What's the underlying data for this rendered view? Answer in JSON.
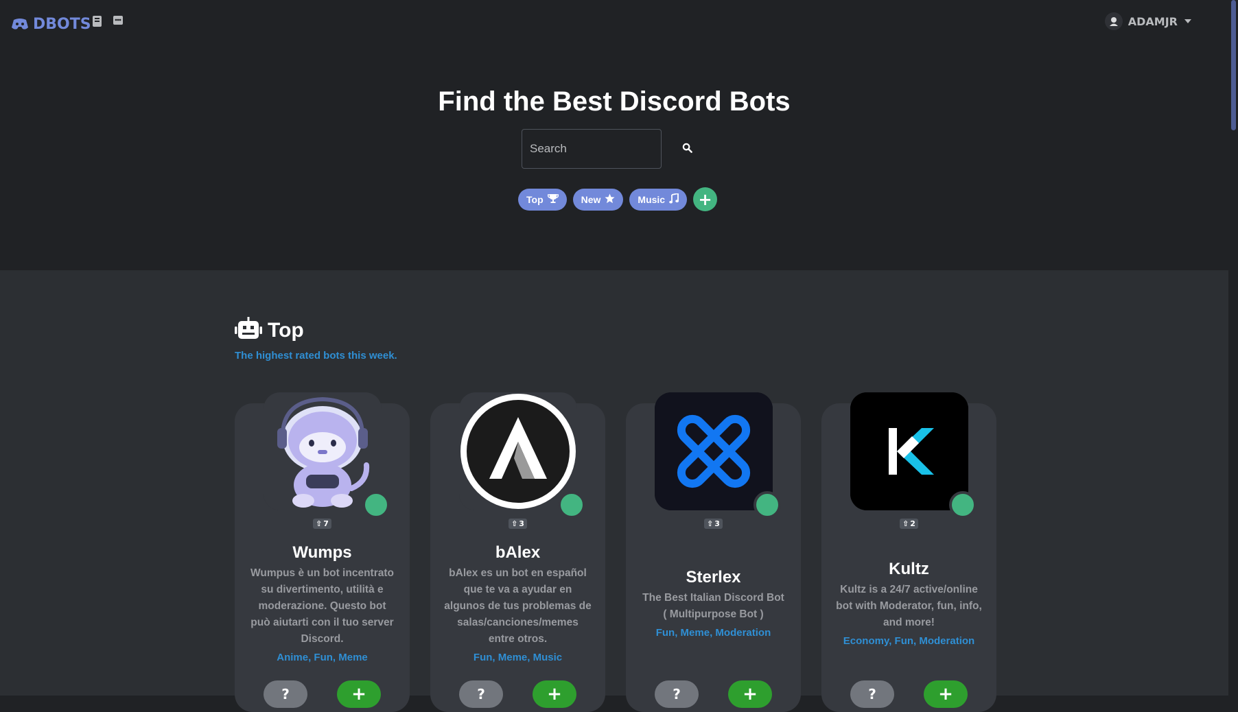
{
  "brand": {
    "name": "DBOTS",
    "color": "#7289da"
  },
  "user": {
    "name": "ADAMJR"
  },
  "hero": {
    "title": "Find the Best Discord Bots",
    "search_placeholder": "Search",
    "chips": [
      {
        "label": "Top",
        "icon": "trophy-icon"
      },
      {
        "label": "New",
        "icon": "star-icon"
      },
      {
        "label": "Music",
        "icon": "music-note-icon"
      }
    ],
    "add_chip_icon": "plus-icon"
  },
  "section": {
    "title": "Top",
    "subtitle": "The highest rated bots this week."
  },
  "bots": [
    {
      "name": "Wumps",
      "votes": "7",
      "description": "Wumpus è un bot incentrato su divertimento, utilità e moderazione. Questo bot può aiutarti con il tuo server Discord.",
      "tags": "Anime, Fun, Meme",
      "info_label": "?",
      "invite_label": "+"
    },
    {
      "name": "bAlex",
      "votes": "3",
      "description": "bAlex es un bot en español que te va a ayudar en algunos de tus problemas de salas/canciones/memes entre otros.",
      "tags": "Fun, Meme, Music",
      "info_label": "?",
      "invite_label": "+"
    },
    {
      "name": "Sterlex",
      "votes": "3",
      "description": "The Best Italian Discord Bot ( Multipurpose Bot )",
      "tags": "Fun, Meme, Moderation",
      "info_label": "?",
      "invite_label": "+"
    },
    {
      "name": "Kultz",
      "votes": "2",
      "description": "Kultz is a 24/7 active/online bot with Moderator, fun, info, and more!",
      "tags": "Economy, Fun, Moderation",
      "info_label": "?",
      "invite_label": "+"
    }
  ],
  "colors": {
    "background": "#202225",
    "section": "#2c2f33",
    "card": "#36393f",
    "accent": "#7289da",
    "online": "#43b581",
    "link": "#2f8fd4"
  }
}
